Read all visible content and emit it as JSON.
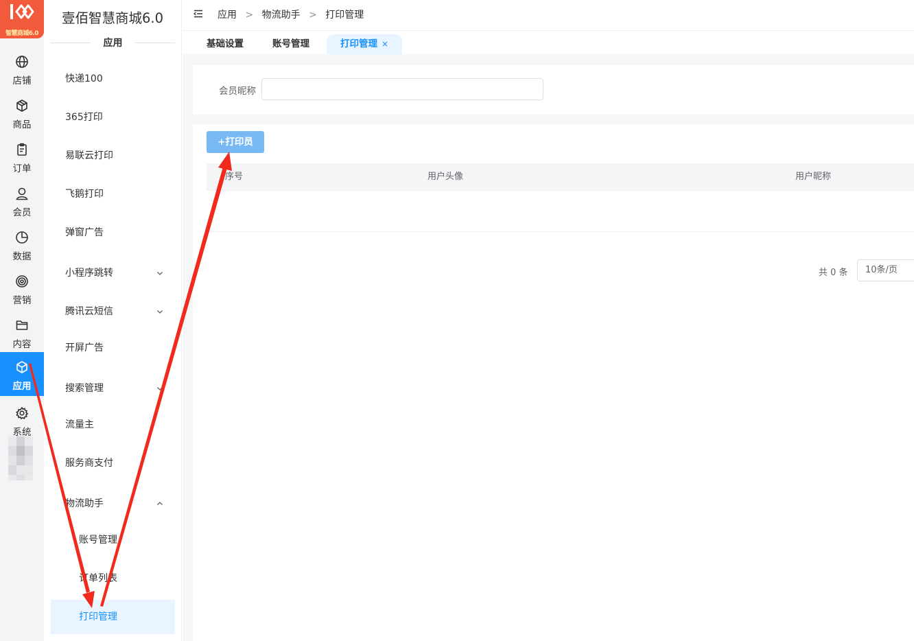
{
  "logo": {
    "text": "智慧商城6.0"
  },
  "rail": {
    "items": [
      {
        "label": "店铺",
        "icon": "globe-icon"
      },
      {
        "label": "商品",
        "icon": "box-icon"
      },
      {
        "label": "订单",
        "icon": "clipboard-icon"
      },
      {
        "label": "会员",
        "icon": "user-icon"
      },
      {
        "label": "数据",
        "icon": "pie-chart-icon"
      },
      {
        "label": "营销",
        "icon": "target-icon"
      },
      {
        "label": "内容",
        "icon": "folder-icon"
      },
      {
        "label": "应用",
        "icon": "cube-icon",
        "active": true
      },
      {
        "label": "系统",
        "icon": "gear-icon"
      }
    ]
  },
  "submenu": {
    "brand": "壹佰智慧商城6.0",
    "section_title": "应用",
    "items": [
      {
        "label": "快递100"
      },
      {
        "label": "365打印"
      },
      {
        "label": "易联云打印"
      },
      {
        "label": "飞鹅打印"
      },
      {
        "label": "弹窗广告"
      },
      {
        "label": "小程序跳转",
        "expand": "down"
      },
      {
        "label": "腾讯云短信",
        "expand": "down"
      },
      {
        "label": "开屏广告"
      },
      {
        "label": "搜索管理",
        "expand": "down"
      },
      {
        "label": "流量主"
      },
      {
        "label": "服务商支付"
      },
      {
        "label": "物流助手",
        "expand": "up"
      }
    ],
    "children": [
      {
        "label": "账号管理"
      },
      {
        "label": "订单列表"
      },
      {
        "label": "打印管理",
        "active": true
      }
    ]
  },
  "breadcrumb": {
    "items": [
      "应用",
      "物流助手",
      "打印管理"
    ],
    "separator": ">"
  },
  "tabs": [
    {
      "label": "基础设置"
    },
    {
      "label": "账号管理"
    },
    {
      "label": "打印管理",
      "active": true,
      "close": "×"
    }
  ],
  "filter": {
    "label": "会员昵称",
    "value": "",
    "placeholder": ""
  },
  "toolbar": {
    "add_label": "+打印员"
  },
  "table": {
    "columns": [
      "序号",
      "用户头像",
      "用户昵称"
    ],
    "rows": []
  },
  "pagination": {
    "total_text": "共 0 条",
    "page_size": "10条/页"
  },
  "colors": {
    "accent": "#1890ff",
    "annotation": "#f02b1e",
    "logo": "#f15a3a"
  }
}
